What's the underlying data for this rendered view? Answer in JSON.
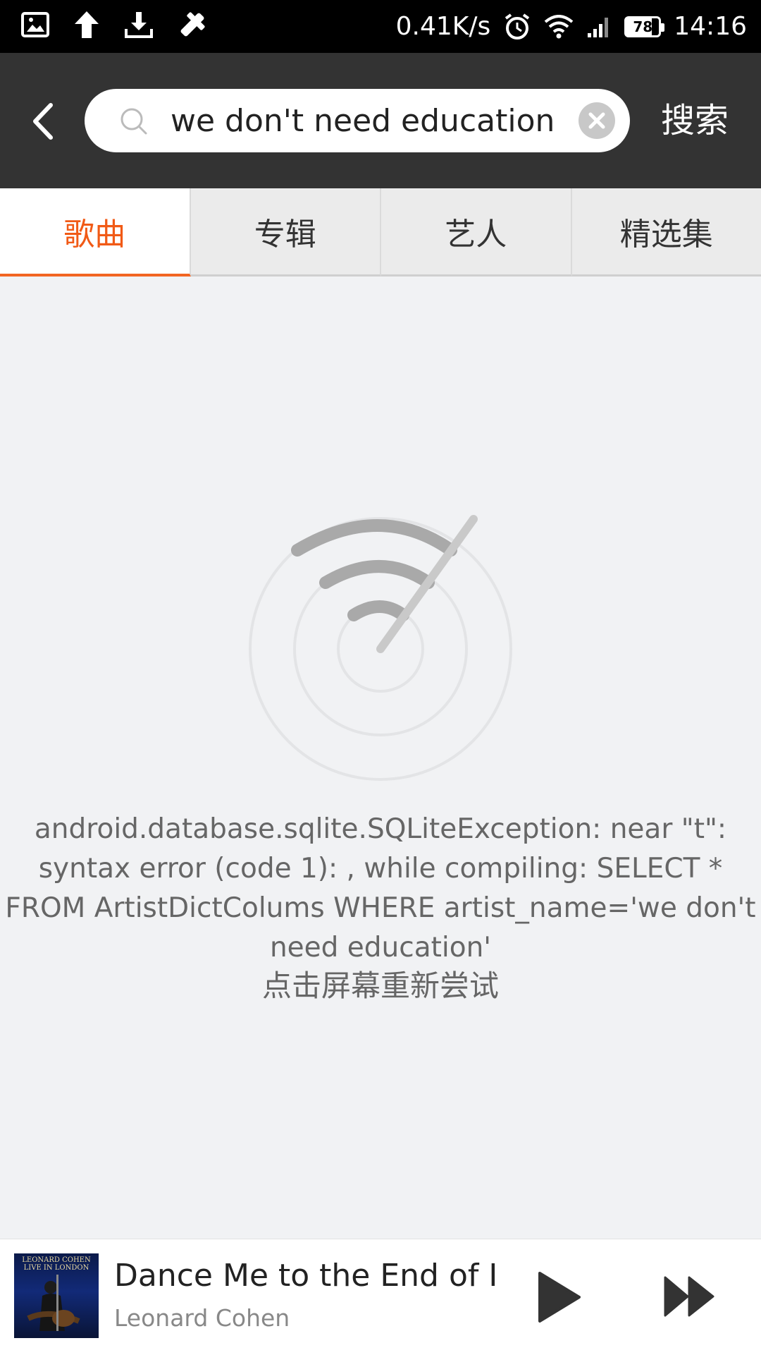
{
  "status_bar": {
    "net_speed": "0.41K/s",
    "battery": "78",
    "time": "14:16"
  },
  "header": {
    "search_value": "we don't need education",
    "search_button": "搜索"
  },
  "tabs": [
    {
      "label": "歌曲",
      "active": true
    },
    {
      "label": "专辑",
      "active": false
    },
    {
      "label": "艺人",
      "active": false
    },
    {
      "label": "精选集",
      "active": false
    }
  ],
  "error": {
    "message": "android.database.sqlite.SQLiteException: near \"t\": syntax error (code 1): , while compiling: SELECT * FROM ArtistDictColums WHERE artist_name='we don't need education'",
    "retry": "点击屏幕重新尝试"
  },
  "player": {
    "album_label": "LEONARD COHEN LIVE IN LONDON",
    "title": "Dance Me to the End of Love",
    "artist": "Leonard Cohen"
  },
  "colors": {
    "accent": "#f26522",
    "header_bg": "#333333",
    "page_bg": "#f1f2f4"
  }
}
